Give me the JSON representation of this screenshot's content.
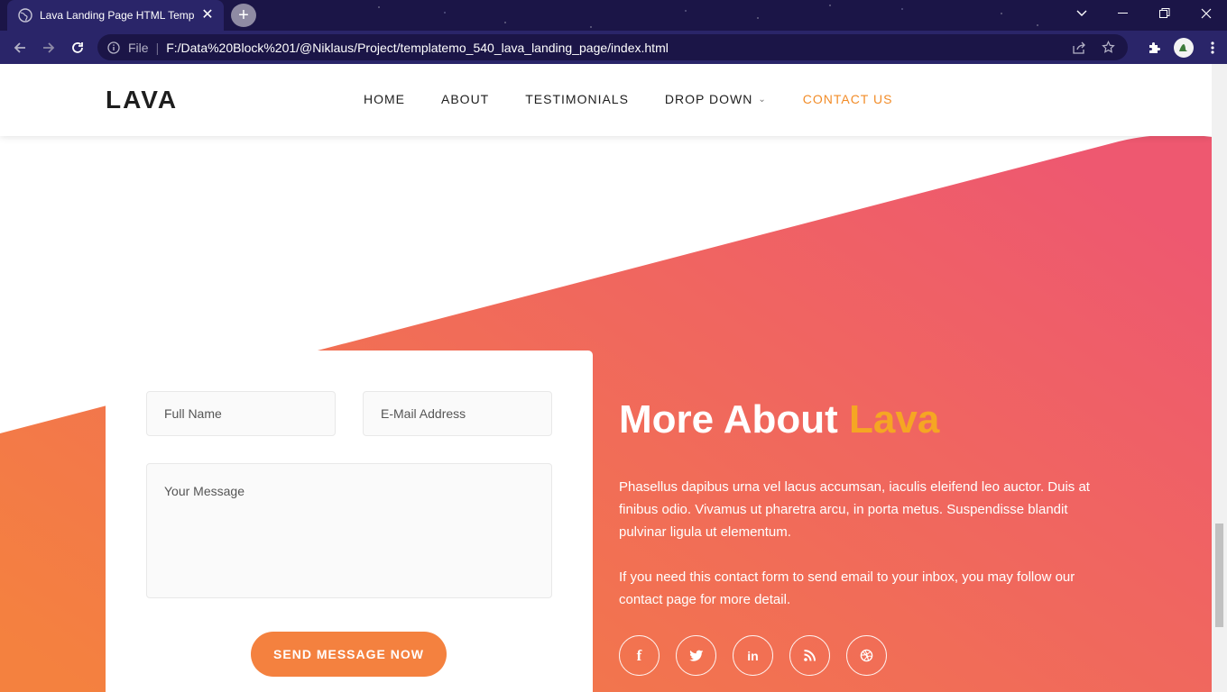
{
  "browser": {
    "tab_title": "Lava Landing Page HTML Template",
    "close_glyph": "✕",
    "newtab_glyph": "+",
    "file_label": "File",
    "separator": "|",
    "url": "F:/Data%20Block%201/@Niklaus/Project/templatemo_540_lava_landing_page/index.html"
  },
  "header": {
    "logo": "LAVA",
    "nav": [
      {
        "label": "HOME"
      },
      {
        "label": "ABOUT"
      },
      {
        "label": "TESTIMONIALS"
      },
      {
        "label": "DROP DOWN",
        "caret": "⌄"
      },
      {
        "label": "CONTACT US"
      }
    ]
  },
  "form": {
    "name_placeholder": "Full Name",
    "email_placeholder": "E-Mail Address",
    "message_placeholder": "Your Message",
    "submit_label": "SEND MESSAGE NOW"
  },
  "about": {
    "title_prefix": "More About ",
    "title_accent": "Lava",
    "paragraph1": "Phasellus dapibus urna vel lacus accumsan, iaculis eleifend leo auctor. Duis at finibus odio. Vivamus ut pharetra arcu, in porta metus. Suspendisse blandit pulvinar ligula ut elementum.",
    "paragraph2": "If you need this contact form to send email to your inbox, you may follow our contact page for more detail."
  },
  "socials": [
    {
      "icon": "facebook-icon",
      "glyph": "f"
    },
    {
      "icon": "twitter-icon",
      "glyph": "t"
    },
    {
      "icon": "linkedin-icon",
      "glyph": "in"
    },
    {
      "icon": "rss-icon",
      "glyph": ""
    },
    {
      "icon": "dribbble-icon",
      "glyph": ""
    }
  ],
  "colors": {
    "accent": "#f28c28",
    "brand_gradient_start": "#f4813f",
    "brand_gradient_end": "#ee5870",
    "title_accent": "#f5a623",
    "browser_frame": "#2a2569"
  }
}
